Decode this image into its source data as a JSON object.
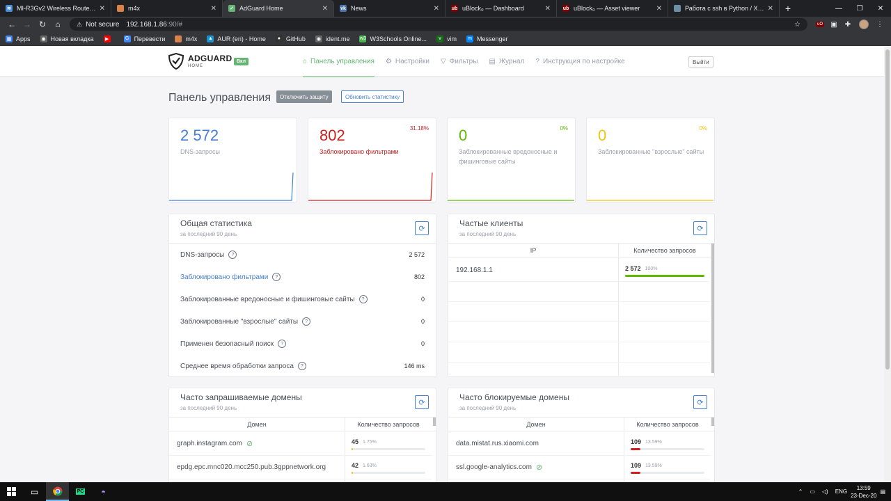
{
  "browser": {
    "tabs": [
      {
        "title": "MI-R3Gv2 Wireless Router - Ин...",
        "color": "#4a90d9",
        "glyph": "≋"
      },
      {
        "title": "m4x",
        "color": "#d9824a",
        "glyph": ""
      },
      {
        "title": "AdGuard Home",
        "color": "#66b574",
        "glyph": "✓",
        "active": true
      },
      {
        "title": "News",
        "color": "#4a76a8",
        "glyph": "vk"
      },
      {
        "title": "uBlock₀ — Dashboard",
        "color": "#800000",
        "glyph": "ub"
      },
      {
        "title": "uBlock₀ — Asset viewer",
        "color": "#800000",
        "glyph": "ub"
      },
      {
        "title": "Работа с ssh в Python / Хабр",
        "color": "#6d8fa6",
        "glyph": ""
      }
    ],
    "new_tab": "+",
    "address": {
      "warning": "⚠",
      "not_secure": "Not secure",
      "host": "192.168.1.86",
      "rest": ":90/#"
    },
    "bookmarks": [
      {
        "label": "Apps",
        "color": "#4285f4",
        "glyph": "▦"
      },
      {
        "label": "Новая вкладка",
        "color": "#666",
        "glyph": "◉"
      },
      {
        "label": "",
        "color": "#ff0000",
        "glyph": "▶"
      },
      {
        "label": "Перевести",
        "color": "#4285f4",
        "glyph": "G"
      },
      {
        "label": "m4x",
        "color": "#d9824a",
        "glyph": ""
      },
      {
        "label": "AUR (en) - Home",
        "color": "#1793d1",
        "glyph": "▲"
      },
      {
        "label": "GitHub",
        "color": "#333",
        "glyph": "●"
      },
      {
        "label": "ident.me",
        "color": "#666",
        "glyph": "◉"
      },
      {
        "label": "W3Schools Online...",
        "color": "#4caf50",
        "glyph": "w3"
      },
      {
        "label": "vim",
        "color": "#1b6b1b",
        "glyph": "v"
      },
      {
        "label": "Messenger",
        "color": "#0084ff",
        "glyph": "m"
      }
    ]
  },
  "app": {
    "brand": "ADGUARD",
    "brand_sub": "HOME",
    "status_badge": "Вкл",
    "nav": [
      {
        "label": "Панель управления",
        "icon": "⌂",
        "active": true
      },
      {
        "label": "Настройки",
        "icon": "⚙",
        "active": false
      },
      {
        "label": "Фильтры",
        "icon": "▽",
        "active": false
      },
      {
        "label": "Журнал",
        "icon": "▤",
        "active": false
      },
      {
        "label": "Инструкция по настройке",
        "icon": "?",
        "active": false
      }
    ],
    "logout": "Выйти"
  },
  "dashboard": {
    "title": "Панель управления",
    "disable_button": "Отключить защиту",
    "refresh_button": "Обновить статистику",
    "stat_cards": [
      {
        "value": "2 572",
        "label": "DNS-запросы",
        "percent": "",
        "color": "#467fcf"
      },
      {
        "value": "802",
        "label": "Заблокировано фильтрами",
        "percent": "31.18%",
        "color": "#cd201f"
      },
      {
        "value": "0",
        "label": "Заблокированные вредоносные и фишинговые сайты",
        "percent": "0%",
        "color": "#5eba00"
      },
      {
        "value": "0",
        "label": "Заблокированные \"взрослые\" сайты",
        "percent": "0%",
        "color": "#f1c40f"
      }
    ],
    "general": {
      "title": "Общая статистика",
      "period": "за последний 90 день",
      "rows": [
        {
          "label": "DNS-запросы",
          "value": "2 572"
        },
        {
          "label": "Заблокировано фильтрами",
          "value": "802"
        },
        {
          "label": "Заблокированные вредоносные и фишинговые сайты",
          "value": "0"
        },
        {
          "label": "Заблокированные \"взрослые\" сайты",
          "value": "0"
        },
        {
          "label": "Применен безопасный поиск",
          "value": "0"
        },
        {
          "label": "Среднее время обработки запроса",
          "value": "146 ms"
        }
      ]
    },
    "clients": {
      "title": "Частые клиенты",
      "period": "за последний 90 день",
      "col_ip": "IP",
      "col_count": "Количество запросов",
      "rows": [
        {
          "ip": "192.168.1.1",
          "count": "2 572",
          "percent": "100%",
          "fraction": 1.0
        }
      ]
    },
    "top_domains": {
      "title": "Часто запрашиваемые домены",
      "period": "за последний 90 день",
      "col_domain": "Домен",
      "col_count": "Количество запросов",
      "rows": [
        {
          "domain": "graph.instagram.com",
          "count": "45",
          "percent": "1.75%",
          "fraction": 0.0175
        },
        {
          "domain": "epdg.epc.mnc020.mcc250.pub.3gppnetwork.org",
          "count": "42",
          "percent": "1.63%",
          "fraction": 0.0163
        }
      ]
    },
    "blocked_domains": {
      "title": "Часто блокируемые домены",
      "period": "за последний 90 день",
      "col_domain": "Домен",
      "col_count": "Количество запросов",
      "rows": [
        {
          "domain": "data.mistat.rus.xiaomi.com",
          "count": "109",
          "percent": "13.59%",
          "fraction": 0.1359
        },
        {
          "domain": "ssl.google-analytics.com",
          "count": "109",
          "percent": "13.59%",
          "fraction": 0.1359
        }
      ]
    }
  },
  "taskbar": {
    "lang": "ENG",
    "time": "13:59",
    "date": "23-Dec-20"
  }
}
